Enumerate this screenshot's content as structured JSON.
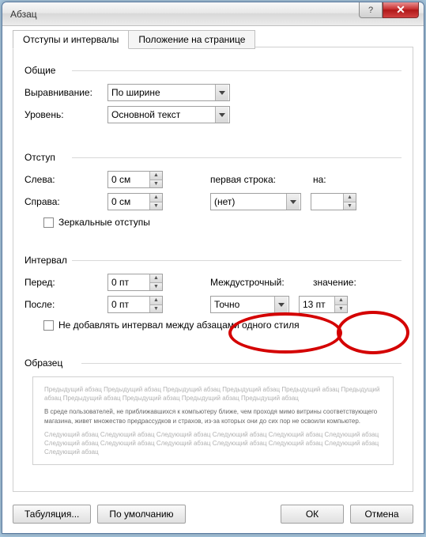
{
  "title": "Абзац",
  "tabs": {
    "active": "Отступы и интервалы",
    "inactive": "Положение на странице"
  },
  "groups": {
    "common": "Общие",
    "indent": "Отступ",
    "interval": "Интервал",
    "preview": "Образец"
  },
  "common": {
    "align_label": "Выравнивание:",
    "align_value": "По ширине",
    "level_label": "Уровень:",
    "level_value": "Основной текст"
  },
  "indent": {
    "left_label": "Слева:",
    "left_value": "0 см",
    "right_label": "Справа:",
    "right_value": "0 см",
    "firstline_label": "первая строка:",
    "firstline_value": "(нет)",
    "by_label": "на:",
    "by_value": "",
    "mirror_label": "Зеркальные отступы"
  },
  "interval": {
    "before_label": "Перед:",
    "before_value": "0 пт",
    "after_label": "После:",
    "after_value": "0 пт",
    "linespacing_label": "Междустрочный:",
    "linespacing_value": "Точно",
    "at_label": "значение:",
    "at_value": "13 пт",
    "noadd_label": "Не добавлять интервал между абзацами одного стиля"
  },
  "preview": {
    "grey1": "Предыдущий абзац Предыдущий абзац Предыдущий абзац Предыдущий абзац Предыдущий абзац Предыдущий абзац Предыдущий абзац Предыдущий абзац Предыдущий абзац Предыдущий абзац",
    "dark": "В среде пользователей, не приближавшихся к компьютеру ближе, чем проходя мимо витрины соответствующего магазина, живет множество предрассудков и страхов, из-за которых они до сих пор не освоили компьютер.",
    "grey2": "Следующий абзац Следующий абзац Следующий абзац Следующий абзац Следующий абзац Следующий абзац Следующий абзац Следующий абзац Следующий абзац Следующий абзац Следующий абзац Следующий абзац Следующий абзац"
  },
  "buttons": {
    "tabs": "Табуляция...",
    "default": "По умолчанию",
    "ok": "ОК",
    "cancel": "Отмена"
  }
}
